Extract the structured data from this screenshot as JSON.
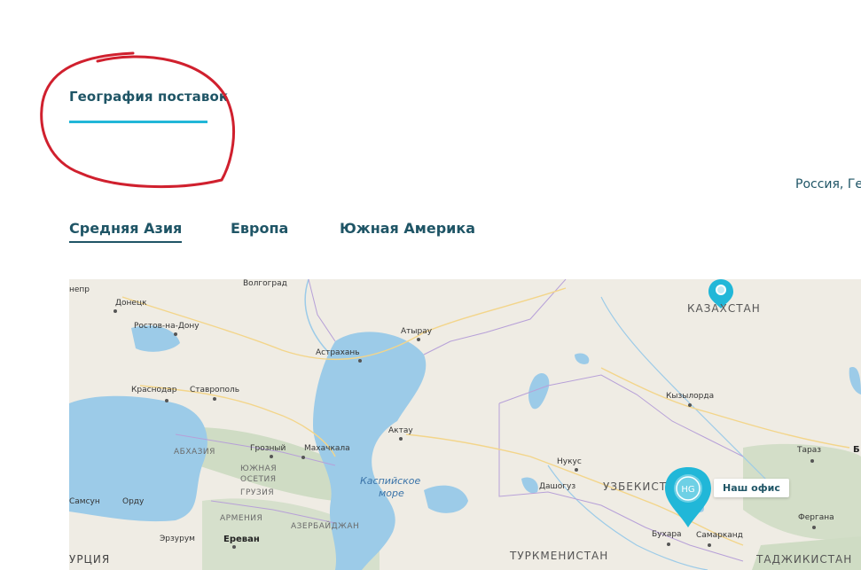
{
  "section": {
    "title": "География поставок",
    "countries_text": "Россия, Ге"
  },
  "tabs": [
    {
      "label": "Средняя Азия",
      "active": true
    },
    {
      "label": "Европа",
      "active": false
    },
    {
      "label": "Южная Америка",
      "active": false
    }
  ],
  "map": {
    "office_label": "Наш офис",
    "office_logo_text": "HG",
    "labels": {
      "dnepr": "непр",
      "volgograd": "Волгоград",
      "donetsk": "Донецк",
      "rostov": "Ростов-на-Дону",
      "atyrau": "Атырау",
      "astrakhan": "Астрахань",
      "krasnodar": "Краснодар",
      "stavropol": "Ставрополь",
      "aktau": "Актау",
      "abkhazia": "АБХАЗИЯ",
      "grozny": "Грозный",
      "makhachkala": "Махачкала",
      "south_ossetia_1": "ЮЖНАЯ",
      "south_ossetia_2": "ОСЕТИЯ",
      "georgia": "ГРУЗИЯ",
      "caspian_1": "Каспийское",
      "caspian_2": "море",
      "samsun": "Самсун",
      "ordu": "Орду",
      "armenia": "АРМЕНИЯ",
      "azerbaijan": "АЗЕРБАЙДЖАН",
      "erzurum": "Эрзурум",
      "yerevan": "Ереван",
      "turkey": "УРЦИЯ",
      "kazakhstan": "КАЗАХСТАН",
      "kyzylorda": "Кызылорда",
      "nukus": "Нукус",
      "dashoguz": "Дашогуз",
      "uzbekistan": "УЗБЕКИСТ",
      "bukhara": "Бухара",
      "samarkand": "Самарканд",
      "turkmenistan": "ТУРКМЕНИСТАН",
      "taraz": "Тараз",
      "fergana": "Фергана",
      "tajikistan": "ТАДЖИКИСТАН",
      "b_edge": "Б"
    }
  },
  "colors": {
    "accent": "#21b7d8",
    "heading": "#1f5566",
    "annotation": "#d0202e",
    "water": "#9ccbe8",
    "land": "#efece4"
  }
}
